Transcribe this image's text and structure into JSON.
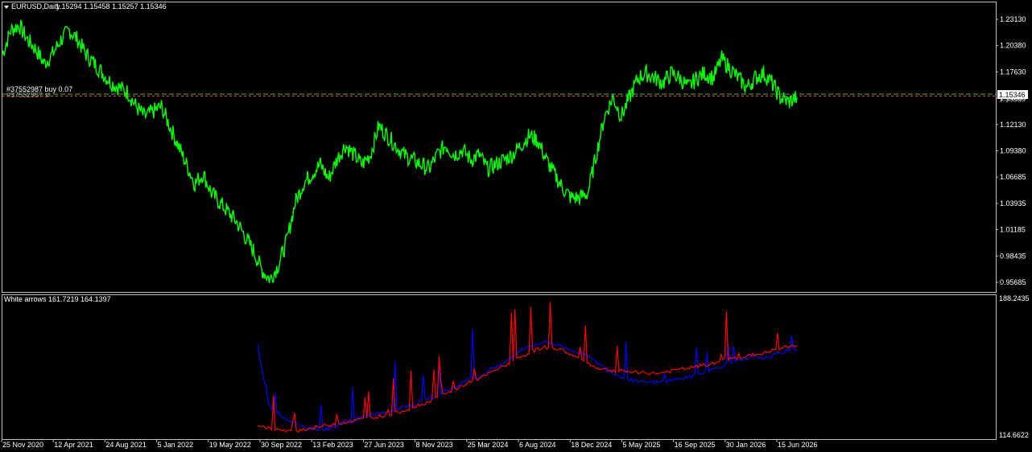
{
  "main_panel": {
    "symbol_label": "EURUSD,Daily",
    "ohlc": "1.15294 1.15458 1.15257 1.15346",
    "current_price_label": "1.15346",
    "order_label_1": "#37552987 buy 0.07",
    "order_label_2": "#37552987 sl",
    "order_price_label": "1.14880",
    "price_ticks": [
      "1.23130",
      "1.20380",
      "1.17630",
      "1.14880",
      "1.12130",
      "1.09380",
      "1.06685",
      "1.03935",
      "1.01185",
      "0.98435",
      "0.95685"
    ]
  },
  "indicator_panel": {
    "title": "White arrows 161.7219 164.1397",
    "top_label": "188.2435",
    "bottom_label": "114.6622"
  },
  "date_ticks": [
    "25 Nov 2020",
    "12 Apr 2021",
    "24 Aug 2021",
    "5 Jan 2022",
    "19 May 2022",
    "30 Sep 2022",
    "13 Feb 2023",
    "27 Jun 2023",
    "8 Nov 2023",
    "25 Mar 2024",
    "6 Aug 2024",
    "18 Dec 2024",
    "5 May 2025",
    "16 Sep 2025",
    "30 Jan 2026",
    "15 Jun 2026"
  ],
  "colors": {
    "price_line": "#00ff00",
    "blue_line": "#0000ff",
    "red_line": "#ff0000",
    "background": "#000000",
    "frame": "#c0c0c0",
    "order_line": "#3cb371",
    "sl_line": "#ff4500"
  },
  "chart_data": {
    "type": "line",
    "price": {
      "values": [
        1.195,
        1.22,
        1.225,
        1.21,
        1.2,
        1.185,
        1.195,
        1.21,
        1.22,
        1.21,
        1.195,
        1.185,
        1.175,
        1.165,
        1.16,
        1.155,
        1.14,
        1.13,
        1.135,
        1.14,
        1.12,
        1.1,
        1.08,
        1.06,
        1.07,
        1.05,
        1.04,
        1.03,
        1.02,
        1.005,
        0.99,
        0.97,
        0.96,
        0.975,
        1.0,
        1.04,
        1.06,
        1.07,
        1.08,
        1.065,
        1.085,
        1.1,
        1.09,
        1.08,
        1.09,
        1.12,
        1.11,
        1.1,
        1.09,
        1.085,
        1.08,
        1.075,
        1.09,
        1.1,
        1.09,
        1.095,
        1.085,
        1.09,
        1.075,
        1.08,
        1.085,
        1.09,
        1.1,
        1.11,
        1.105,
        1.085,
        1.07,
        1.055,
        1.045,
        1.045,
        1.05,
        1.09,
        1.13,
        1.15,
        1.13,
        1.15,
        1.17,
        1.175,
        1.17,
        1.165,
        1.175,
        1.17,
        1.16,
        1.17,
        1.175,
        1.17,
        1.19,
        1.18,
        1.17,
        1.16,
        1.17,
        1.175,
        1.165,
        1.15,
        1.145,
        1.15
      ]
    },
    "indicator": {
      "range": [
        114.6622,
        188.2435
      ],
      "blue": [
        163,
        131,
        126,
        122,
        119,
        118,
        117,
        118,
        121,
        122,
        124,
        126,
        127,
        128,
        130,
        131,
        134,
        136,
        139,
        141,
        145,
        146,
        150,
        153,
        156,
        161,
        163,
        165,
        164,
        162,
        160,
        158,
        154,
        150,
        147,
        145,
        143,
        143,
        143,
        144,
        145,
        146,
        148,
        150,
        152,
        154,
        155,
        157,
        156,
        158,
        160,
        161
      ],
      "red": [
        120,
        118,
        117,
        116,
        117,
        118,
        119,
        120,
        121,
        122,
        123,
        124,
        125,
        126,
        128,
        130,
        132,
        135,
        137,
        140,
        143,
        145,
        148,
        151,
        154,
        157,
        160,
        162,
        162,
        160,
        157,
        154,
        151,
        150,
        149,
        149,
        148,
        148,
        148,
        149,
        150,
        151,
        152,
        153,
        155,
        156,
        157,
        158,
        159,
        161,
        162,
        163
      ]
    }
  }
}
